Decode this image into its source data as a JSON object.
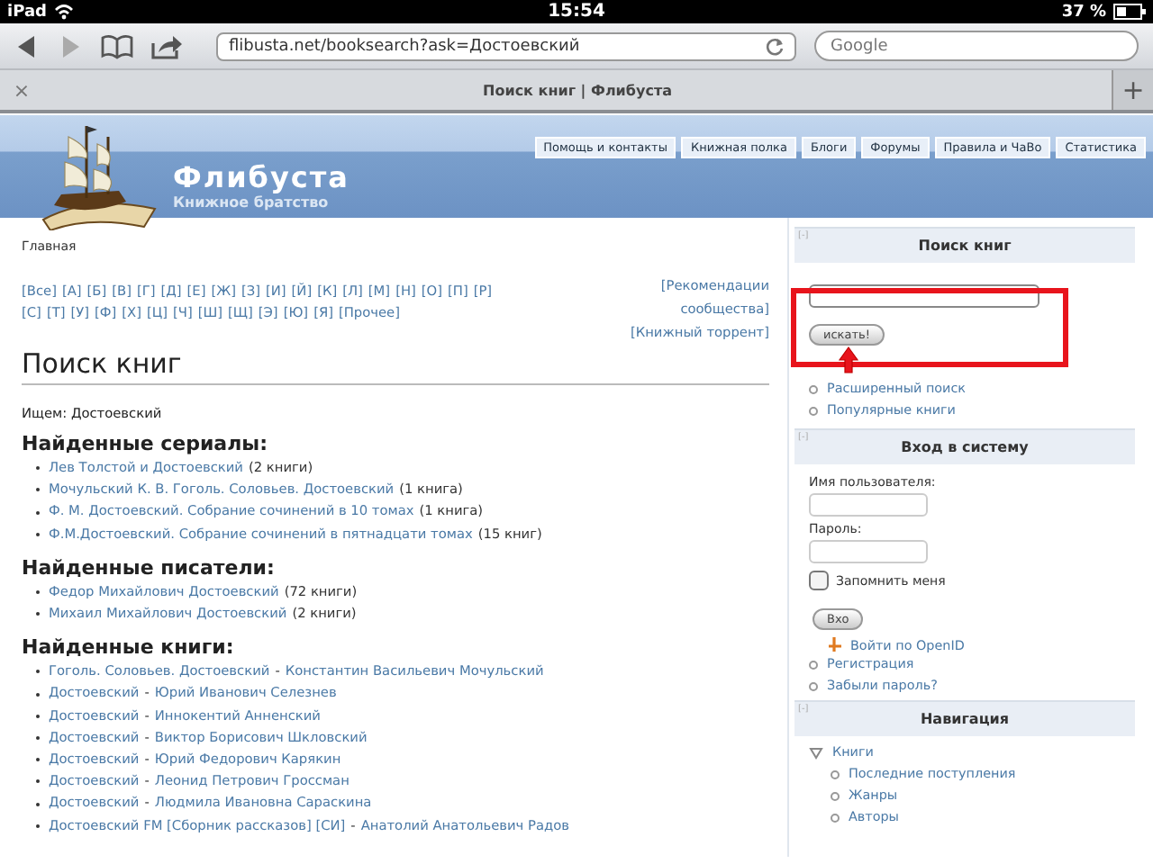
{
  "status_bar": {
    "device": "iPad",
    "time": "15:54",
    "battery": "37 %"
  },
  "browser": {
    "url": "flibusta.net/booksearch?ask=Достоевский",
    "search_placeholder": "Google",
    "tab_title": "Поиск книг | Флибуста",
    "close_tab": "×",
    "new_tab": "+"
  },
  "header": {
    "site_name": "Флибуста",
    "tagline": "Книжное братство",
    "nav": [
      "Помощь и контакты",
      "Книжная полка",
      "Блоги",
      "Форумы",
      "Правила и ЧаВо",
      "Статистика"
    ]
  },
  "main": {
    "breadcrumb": "Главная",
    "alphabet_rows": [
      [
        "[Все]",
        "[А]",
        "[Б]",
        "[В]",
        "[Г]",
        "[Д]",
        "[Е]",
        "[Ж]",
        "[З]",
        "[И]",
        "[Й]",
        "[К]",
        "[Л]",
        "[М]",
        "[Н]",
        "[О]",
        "[П]",
        "[Р]"
      ],
      [
        "[С]",
        "[Т]",
        "[У]",
        "[Ф]",
        "[Х]",
        "[Ц]",
        "[Ч]",
        "[Ш]",
        "[Щ]",
        "[Э]",
        "[Ю]",
        "[Я]",
        "[Прочее]"
      ]
    ],
    "side_links": [
      "[Рекомендации сообщества]",
      "[Книжный торрент]"
    ],
    "title": "Поиск книг",
    "query": "Ищем: Достоевский",
    "sections": [
      {
        "heading": "Найденные сериалы:",
        "items": [
          {
            "link": "Лев Толстой и Достоевский",
            "count": "(2 книги)"
          },
          {
            "link": "Мочульский К. В. Гоголь. Соловьев. Достоевский",
            "count": "(1 книга)"
          },
          {
            "link": "Ф. М. Достоевский. Собрание сочинений в 10 томах",
            "count": "(1 книга)"
          },
          {
            "link": "Ф.М.Достоевский. Собрание сочинений в пятнадцати томах",
            "count": "(15 книг)"
          }
        ]
      },
      {
        "heading": "Найденные писатели:",
        "items": [
          {
            "link": "Федор Михайлович Достоевский",
            "count": "(72 книги)"
          },
          {
            "link": "Михаил Михайлович Достоевский",
            "count": "(2 книги)"
          }
        ]
      },
      {
        "heading": "Найденные книги:",
        "items": [
          {
            "link": "Гоголь. Соловьев. Достоевский",
            "separator": "-",
            "author": "Константин Васильевич Мочульский"
          },
          {
            "link": "Достоевский",
            "separator": "-",
            "author": "Юрий Иванович Селезнев"
          },
          {
            "link": "Достоевский",
            "separator": "-",
            "author": "Иннокентий Анненский"
          },
          {
            "link": "Достоевский",
            "separator": "-",
            "author": "Виктор Борисович Шкловский"
          },
          {
            "link": "Достоевский",
            "separator": "-",
            "author": "Юрий Федорович Карякин"
          },
          {
            "link": "Достоевский",
            "separator": "-",
            "author": "Леонид Петрович Гроссман"
          },
          {
            "link": "Достоевский",
            "separator": "-",
            "author": "Людмила Ивановна Сараскина"
          },
          {
            "link": "Достоевский FM [Сборник рассказов] [СИ]",
            "separator": "-",
            "author": "Анатолий Анатольевич Радов"
          }
        ]
      }
    ]
  },
  "sidebar": {
    "search": {
      "toggle": "[-]",
      "title": "Поиск книг",
      "button": "искать!",
      "links": [
        "Расширенный поиск",
        "Популярные книги"
      ]
    },
    "login": {
      "toggle": "[-]",
      "title": "Вход в систему",
      "username_label": "Имя пользователя:",
      "password_label": "Пароль:",
      "remember": {
        "label": "Запомнить меня",
        "checked": false
      },
      "button": "Вхо",
      "openid": "Войти по OpenID",
      "links": [
        "Регистрация",
        "Забыли пароль?"
      ]
    },
    "navigation": {
      "toggle": "[-]",
      "title": "Навигация",
      "tree": [
        {
          "label": "Книги",
          "expanded": true,
          "children": [
            {
              "label": "Последние поступления"
            },
            {
              "label": "Жанры"
            },
            {
              "label": "Авторы"
            }
          ]
        }
      ]
    }
  }
}
